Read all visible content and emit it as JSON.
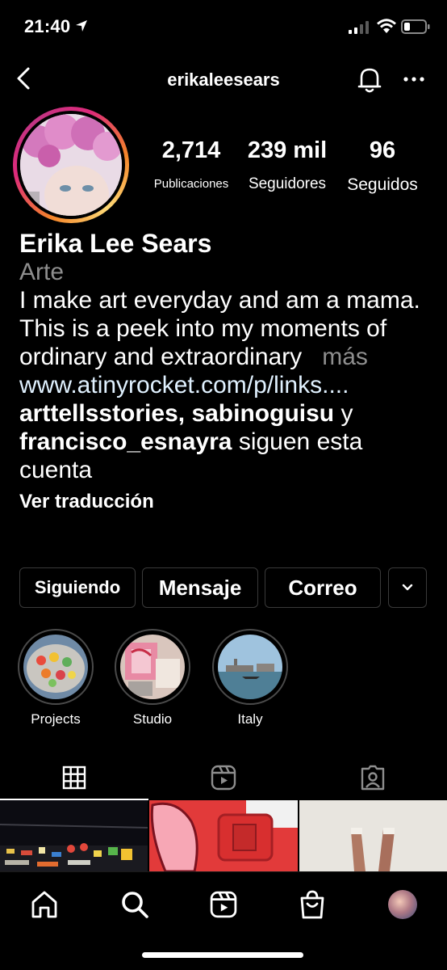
{
  "status_bar": {
    "time": "21:40"
  },
  "header": {
    "username": "erikaleesears"
  },
  "profile": {
    "stats": {
      "posts_count": "2,714",
      "posts_label": "Publicaciones",
      "followers_count": "239 mil",
      "followers_label": "Seguidores",
      "following_count": "96",
      "following_label": "Seguidos"
    },
    "full_name": "Erika Lee Sears",
    "category": "Arte",
    "bio": "I make art everyday and am a mama. This is a peek into my moments of ordinary and extraordinary",
    "bio_more": "más",
    "website": "www.atinyrocket.com/p/links....",
    "followed_by": {
      "user1": "arttellsstories",
      "separator": ", ",
      "user2": "sabinoguisu",
      "conjunction": " y ",
      "user3": "francisco_esnayra",
      "suffix": " siguen esta cuenta"
    },
    "translate_label": "Ver traducción"
  },
  "actions": {
    "following_label": "Siguiendo",
    "message_label": "Mensaje",
    "email_label": "Correo"
  },
  "highlights": [
    {
      "label": "Projects"
    },
    {
      "label": "Studio"
    },
    {
      "label": "Italy"
    }
  ],
  "tabs": {
    "active": "grid"
  },
  "bottom_nav": {
    "active": "profile"
  },
  "colors": {
    "background": "#000000",
    "secondary_text": "#8e8e8e",
    "link_text": "#e0f1ff",
    "button_border": "#3a3a3a",
    "story_ring_start": "#f58529",
    "story_ring_end": "#dd2a7b"
  },
  "icons": {
    "location": "location-arrow-icon",
    "back": "chevron-left-icon",
    "notifications": "bell-icon",
    "more": "more-horizontal-icon",
    "dropdown": "chevron-down-icon",
    "tab_grid": "grid-icon",
    "tab_reels": "reels-icon",
    "tab_tagged": "tagged-person-icon",
    "nav_home": "home-icon",
    "nav_search": "search-icon",
    "nav_reels": "reels-icon",
    "nav_shop": "shopping-bag-icon"
  }
}
